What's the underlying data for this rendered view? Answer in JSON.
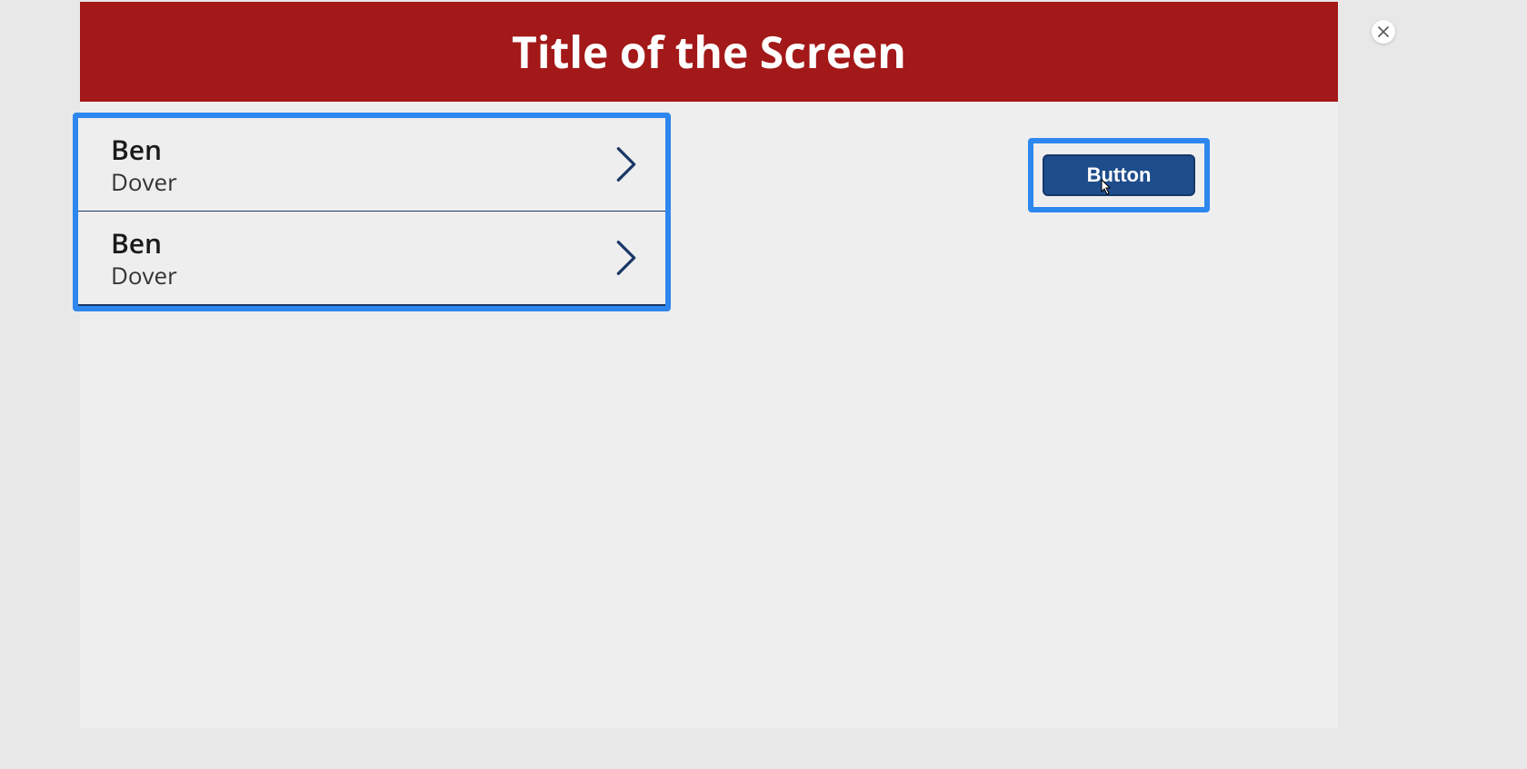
{
  "header": {
    "title": "Title of the Screen"
  },
  "list": {
    "items": [
      {
        "primary": "Ben",
        "secondary": "Dover"
      },
      {
        "primary": "Ben",
        "secondary": "Dover"
      }
    ]
  },
  "actions": {
    "button_label": "Button"
  },
  "colors": {
    "header_bg": "#a31818",
    "highlight_border": "#2d87ee",
    "button_bg": "#1e4d8c"
  }
}
